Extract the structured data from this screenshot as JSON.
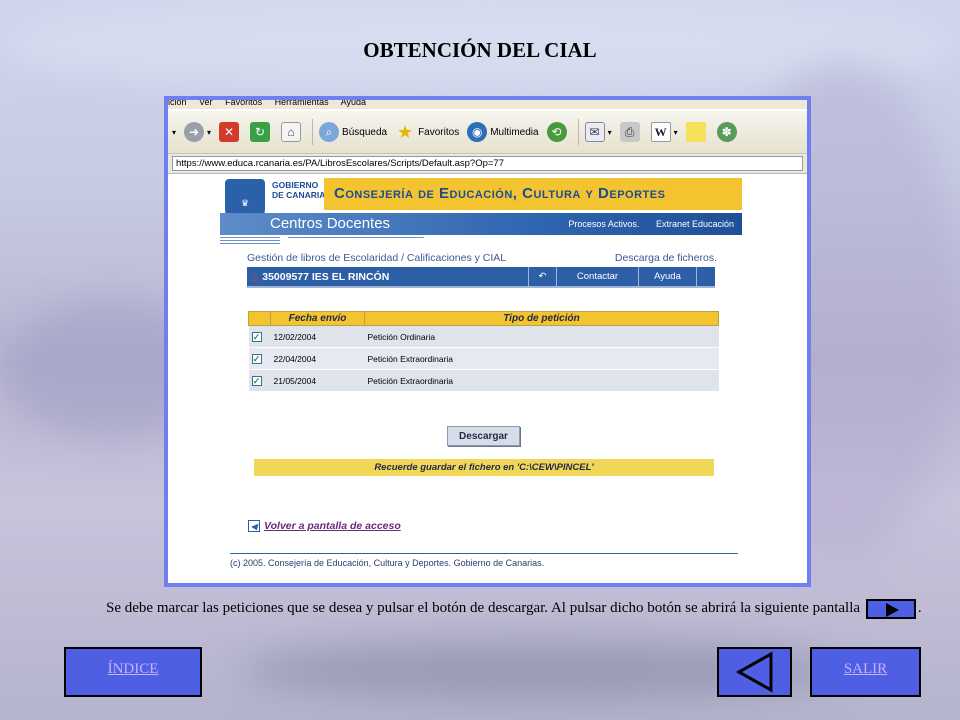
{
  "page": {
    "title": "OBTENCIÓN DEL CIAL",
    "description_prefix": "Se debe marcar las peticiones que se desea y pulsar el botón de descargar. Al pulsar dicho botón se abrirá la siguiente pantalla",
    "description_suffix": "."
  },
  "browser": {
    "menu": [
      "ición",
      "Ver",
      "Favoritos",
      "Herramientas",
      "Ayuda"
    ],
    "toolbar": {
      "search_label": "Búsqueda",
      "favorites_label": "Favoritos",
      "multimedia_label": "Multimedia"
    },
    "address": "https://www.educa.rcanaria.es/PA/LibrosEscolares/Scripts/Default.asp?Op=77"
  },
  "site": {
    "gobierno_line1": "GOBIERNO",
    "gobierno_line2": "DE CANARIAS",
    "consejeria": "Consejería de Educación, Cultura y Deportes",
    "section": "Centros Docentes",
    "links": [
      "Procesos Activos.",
      "Extranet Educación"
    ],
    "subtitle_left": "Gestión de libros de Escolaridad / Calificaciones y CIAL",
    "subtitle_right": "Descarga de ficheros.",
    "school": "35009577 IES EL RINCÓN",
    "back_symbol": "↶",
    "contact_label": "Contactar",
    "help_label": "Ayuda",
    "table": {
      "headers": [
        "Fecha envío",
        "Tipo de petición"
      ],
      "rows": [
        {
          "checked": true,
          "date": "12/02/2004",
          "type": "Petición Ordinaria"
        },
        {
          "checked": true,
          "date": "22/04/2004",
          "type": "Petición Extraordinaria"
        },
        {
          "checked": true,
          "date": "21/05/2004",
          "type": "Petición Extraordinaria"
        }
      ]
    },
    "download_label": "Descargar",
    "reminder": "Recuerde guardar el fichero en 'C:\\CEW\\PINCEL'",
    "back_link": "Volver a pantalla de acceso",
    "footer": "(c) 2005. Consejería de Educación, Cultura y Deportes. Gobierno de Canarias."
  },
  "nav": {
    "index_label": "ÍNDICE",
    "exit_label": "SALIR"
  },
  "colors": {
    "nav_button": "#4f5fe3",
    "frame_border": "#6f7ff0",
    "site_yellow": "#f4c430",
    "site_blue": "#2d5fa6"
  }
}
